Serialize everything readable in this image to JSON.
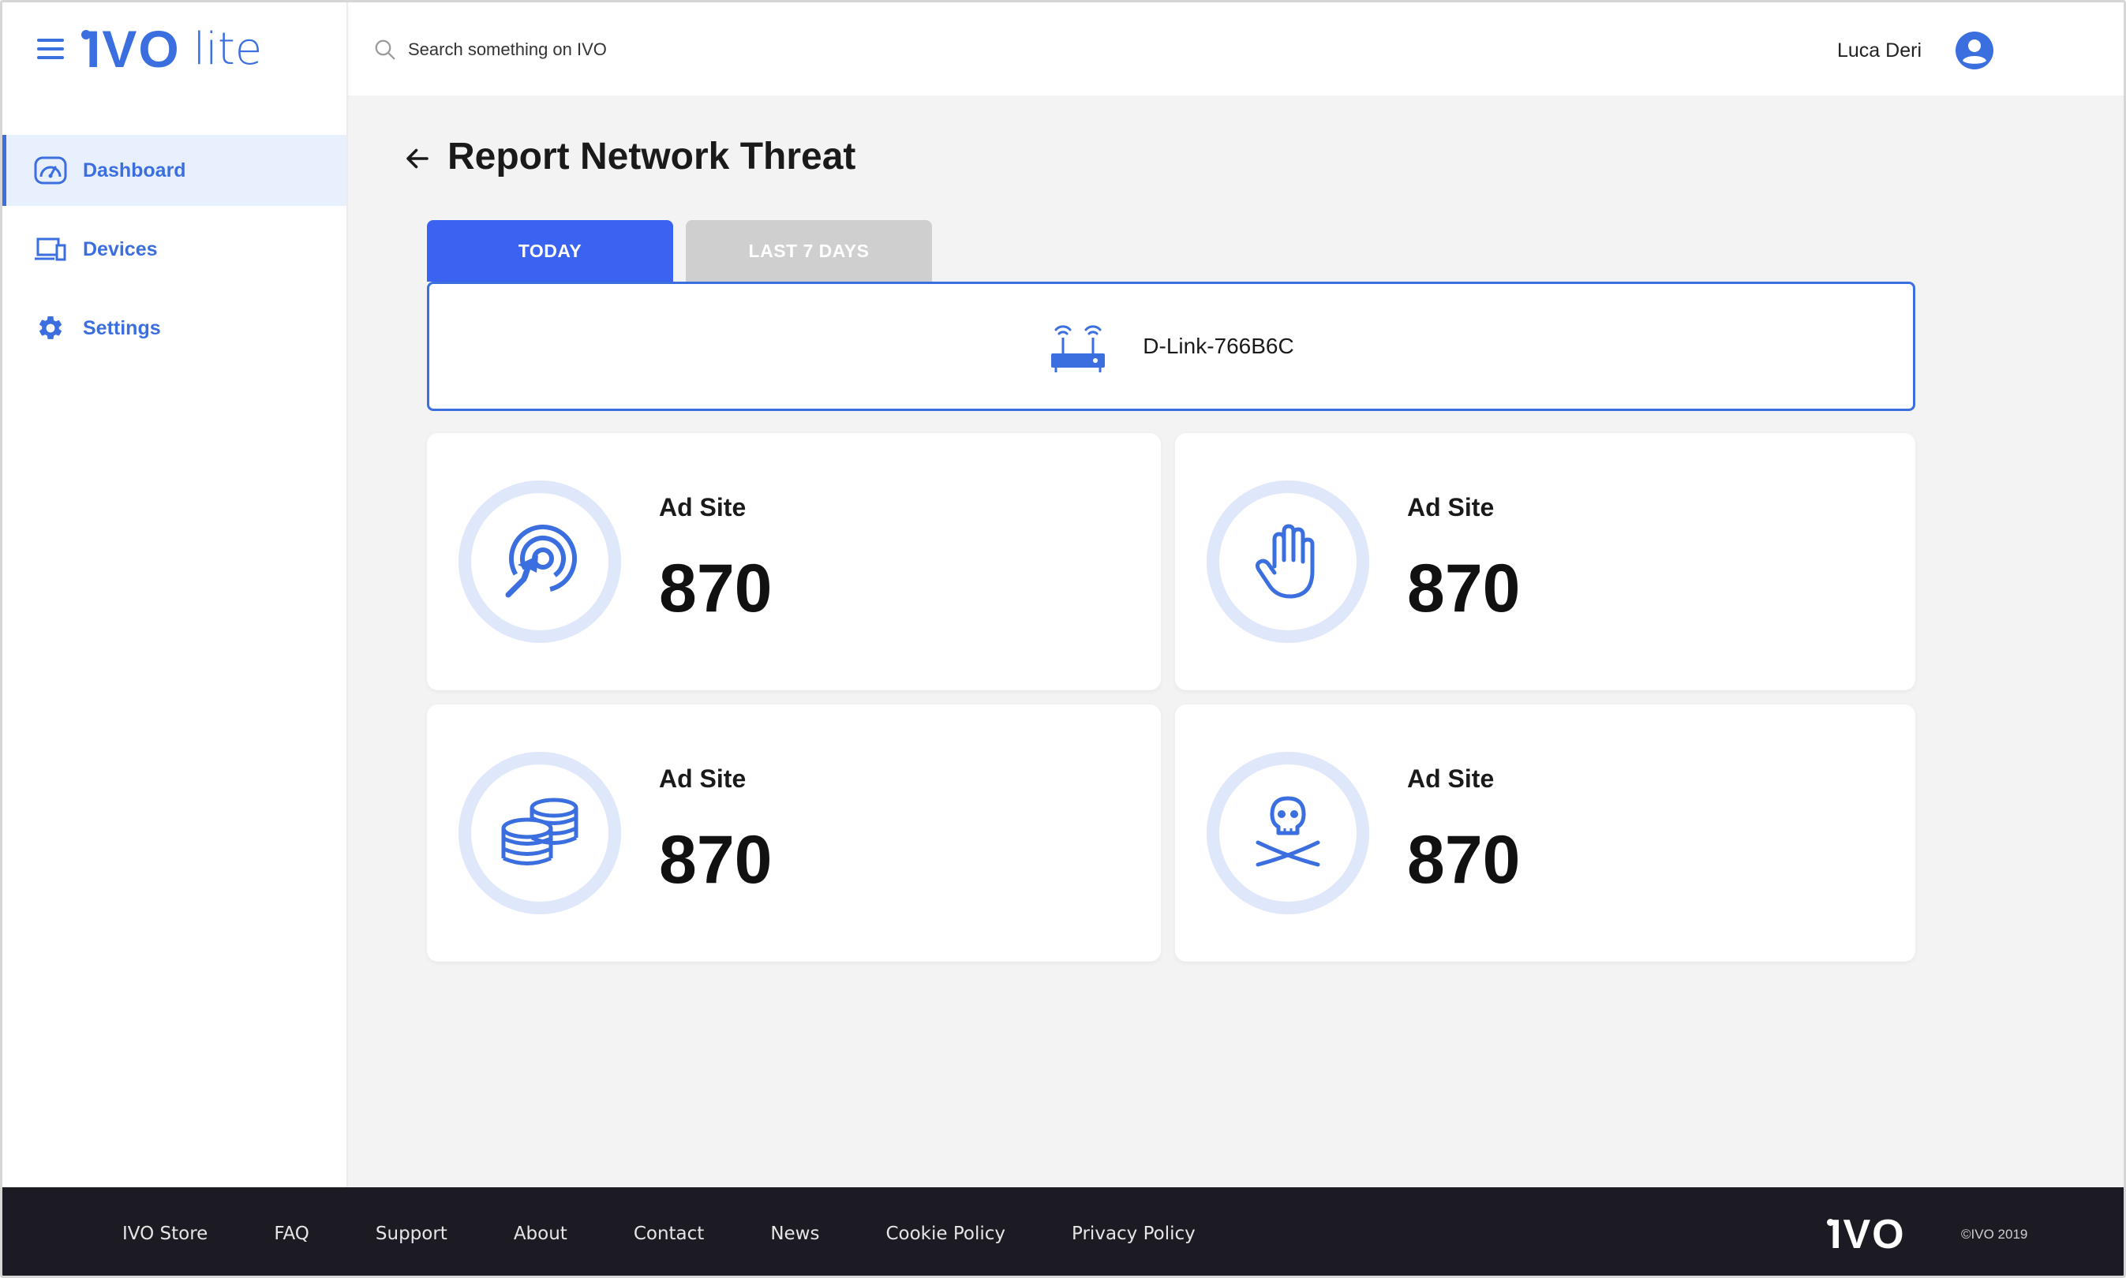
{
  "header": {
    "logo_main": "IVO",
    "logo_suffix": "lite",
    "search_placeholder": "Search something on IVO",
    "user_name": "Luca Deri"
  },
  "sidebar": {
    "items": [
      {
        "label": "Dashboard",
        "icon": "dashboard-gauge-icon",
        "active": true
      },
      {
        "label": "Devices",
        "icon": "devices-icon",
        "active": false
      },
      {
        "label": "Settings",
        "icon": "gear-icon",
        "active": false
      }
    ]
  },
  "page": {
    "title": "Report Network Threat",
    "tabs": [
      {
        "label": "TODAY",
        "active": true
      },
      {
        "label": "LAST 7 DAYS",
        "active": false
      }
    ],
    "device_name": "D-Link-766B6C"
  },
  "cards": [
    {
      "label": "Ad Site",
      "value": "870",
      "icon": "target-click-icon"
    },
    {
      "label": "Ad Site",
      "value": "870",
      "icon": "hand-stop-icon"
    },
    {
      "label": "Ad Site",
      "value": "870",
      "icon": "coins-stack-icon"
    },
    {
      "label": "Ad Site",
      "value": "870",
      "icon": "skull-crossbones-icon"
    }
  ],
  "footer": {
    "links": [
      "IVO Store",
      "FAQ",
      "Support",
      "About",
      "Contact",
      "News",
      "Cookie Policy",
      "Privacy Policy"
    ],
    "logo": "IVO",
    "copyright": "©IVO 2019"
  },
  "colors": {
    "accent": "#3b6fe0",
    "tab_active": "#3a63f2",
    "tab_inactive": "#cfcfcf",
    "icon_ring": "#dfe8fb",
    "footer_bg": "#1c1b23",
    "page_bg": "#f3f3f3"
  }
}
